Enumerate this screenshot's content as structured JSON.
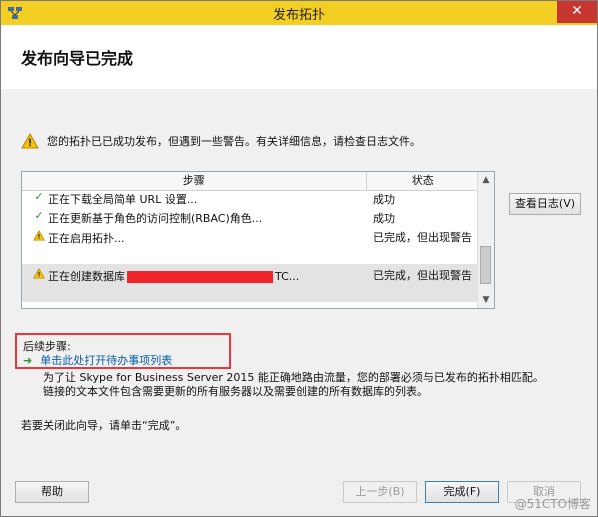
{
  "window": {
    "title": "发布拓扑",
    "close_glyph": "✕"
  },
  "header": {
    "title": "发布向导已完成"
  },
  "status": {
    "message": "您的拓扑已已成功发布，但遇到一些警告。有关详细信息，请检查日志文件。"
  },
  "grid": {
    "columns": [
      "步骤",
      "状态"
    ],
    "rows": [
      {
        "icon": "check-icon",
        "step": "正在下载全局简单 URL 设置...",
        "status": "成功"
      },
      {
        "icon": "check-icon",
        "step": "正在更新基于角色的访问控制(RBAC)角色...",
        "status": "成功"
      },
      {
        "icon": "warning-icon",
        "step": "正在启用拓扑...",
        "status": "已完成，但出现警告"
      },
      {
        "icon": "warning-icon",
        "step_prefix": "正在创建数据库",
        "step_suffix": "TC...",
        "status": "已完成，但出现警告"
      }
    ]
  },
  "buttons": {
    "view_log": "查看日志(V)",
    "help": "帮助",
    "back": "上一步(B)",
    "finish": "完成(F)",
    "cancel": "取消"
  },
  "next_steps": {
    "label": "后续步骤:",
    "link": "单击此处打开待办事项列表"
  },
  "description": {
    "line1": "为了让 Skype for Business Server 2015 能正确地路由流量，您的部署必须与已发布的拓扑相匹配。",
    "line2": "链接的文本文件包含需要更新的所有服务器以及需要创建的所有数据库的列表。"
  },
  "finish_message": "若要关闭此向导，请单击“完成”。",
  "watermark": "@51CTO博客"
}
